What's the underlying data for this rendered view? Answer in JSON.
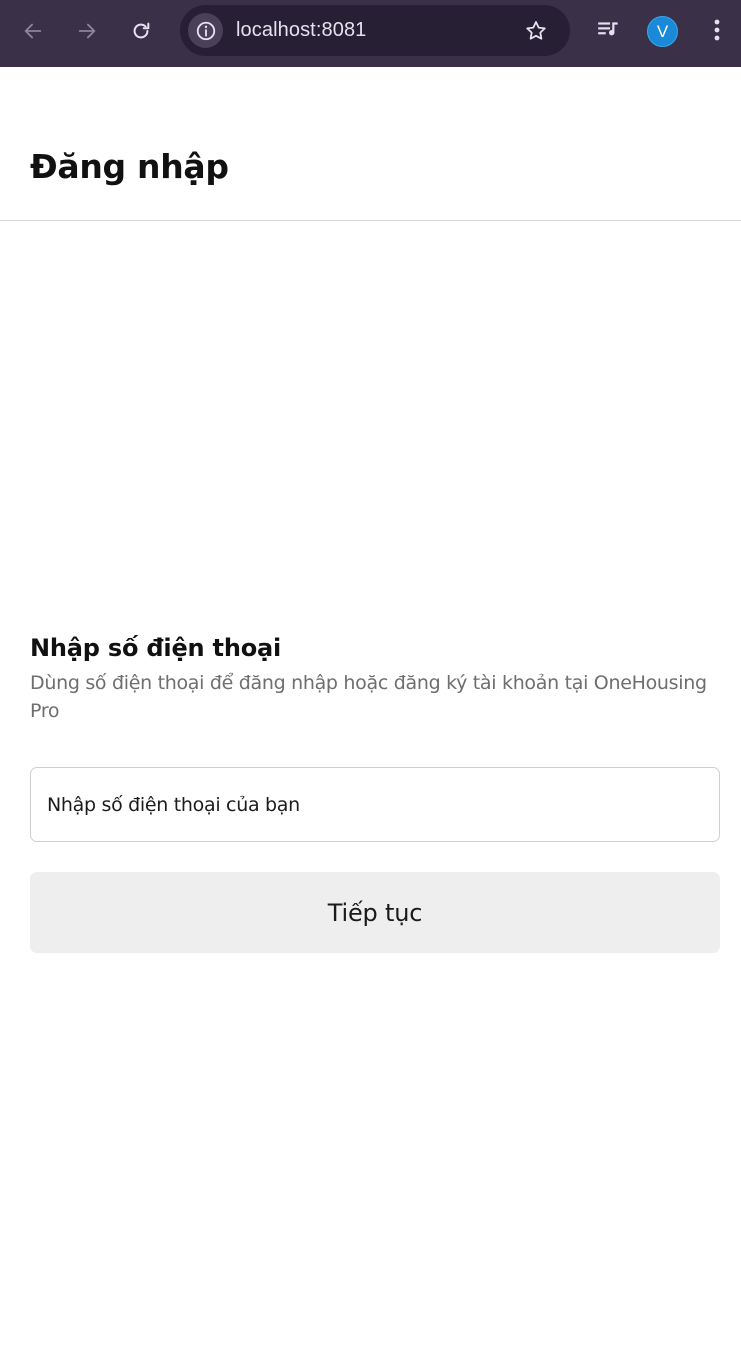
{
  "browser": {
    "url": "localhost:8081",
    "profile_initial": "V",
    "icons": {
      "back": "back-arrow-icon",
      "forward": "forward-arrow-icon",
      "reload": "reload-icon",
      "site_info": "info-icon",
      "bookmark": "star-icon",
      "media": "media-queue-icon",
      "menu": "kebab-menu-icon"
    },
    "colors": {
      "toolbar": "#3a3148",
      "omnibox": "#271f33",
      "avatar": "#1a8ad8"
    }
  },
  "header": {
    "title": "Đăng nhập"
  },
  "login": {
    "section_title": "Nhập số điện thoại",
    "description": "Dùng số điện thoại để đăng nhập hoặc đăng ký tài khoản tại OneHousing Pro",
    "phone_placeholder": "Nhập số điện thoại của bạn",
    "phone_value": "",
    "continue_label": "Tiếp tục"
  }
}
